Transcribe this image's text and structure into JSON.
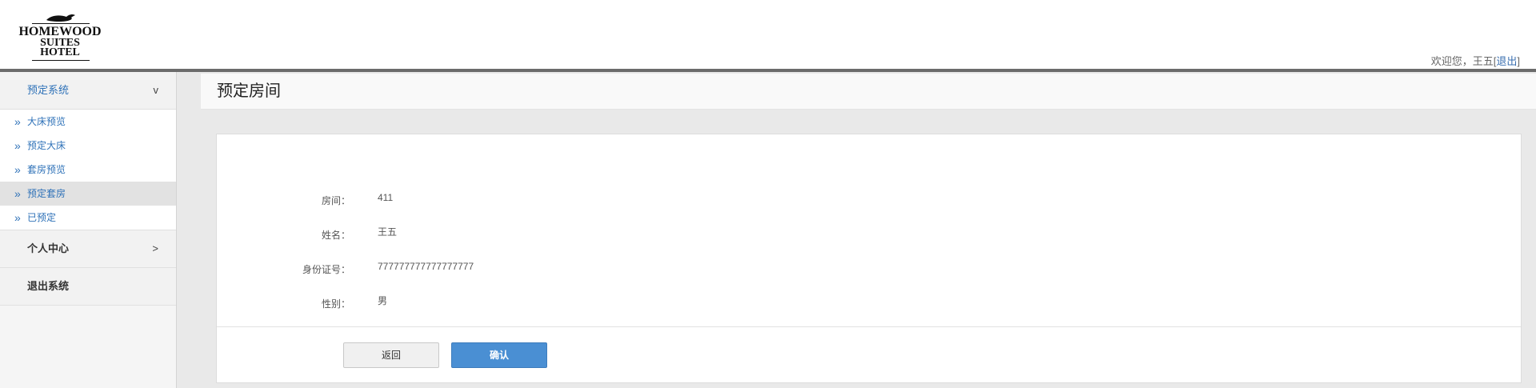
{
  "brand": {
    "logo_line1": "HOMEWOOD",
    "logo_line2": "SUITES",
    "logo_line3": "HOTEL"
  },
  "header": {
    "welcome_prefix": "欢迎您，",
    "user_name": "王五",
    "logout_open": "[",
    "logout_label": "退出",
    "logout_close": "]"
  },
  "sidebar": {
    "groups": [
      {
        "label": "预定系统",
        "chevron": "v",
        "items": [
          {
            "label": "大床预览"
          },
          {
            "label": "预定大床"
          },
          {
            "label": "套房预览"
          },
          {
            "label": "预定套房"
          },
          {
            "label": "已预定"
          }
        ]
      },
      {
        "label": "个人中心",
        "chevron": ">"
      },
      {
        "label": "退出系统"
      }
    ],
    "item_arrow": "»"
  },
  "main": {
    "title": "预定房间",
    "form": {
      "room_label": "房间：",
      "room_value": "411",
      "name_label": "姓名：",
      "name_value": "王五",
      "id_label": "身份证号：",
      "id_value": "777777777777777777",
      "gender_label": "性别：",
      "gender_value": "男"
    },
    "buttons": {
      "back_label": "返回",
      "confirm_label": "确认"
    }
  },
  "colors": {
    "accent": "#2f72b8",
    "confirm_button": "#4a8fd3",
    "header_bar": "#6b6b6b"
  }
}
